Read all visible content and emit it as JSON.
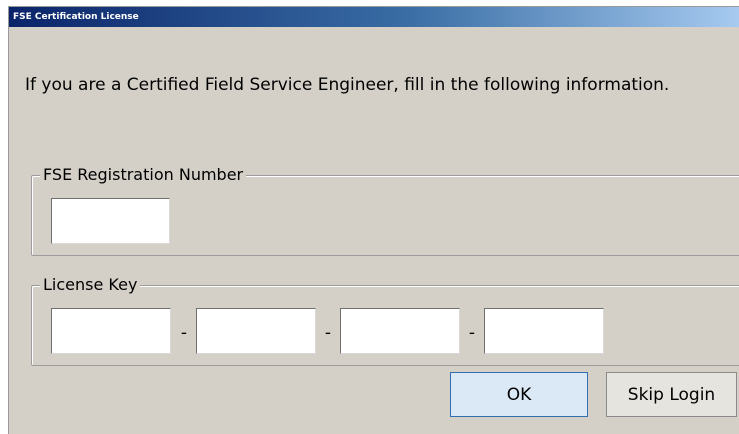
{
  "window": {
    "title": "FSE Certification License"
  },
  "intro_text": "If you are a Certified Field Service Engineer, fill in the following information.",
  "registration": {
    "legend": "FSE Registration Number",
    "value": ""
  },
  "license": {
    "legend": "License Key",
    "separator": "-",
    "segments": [
      "",
      "",
      "",
      ""
    ]
  },
  "buttons": {
    "ok_label": "OK",
    "skip_label": "Skip Login"
  },
  "colors": {
    "dialog_background": "#d4d0c8",
    "titlebar_start": "#0a246a",
    "titlebar_end": "#a6caf0",
    "default_button": "#dbe8f6"
  }
}
